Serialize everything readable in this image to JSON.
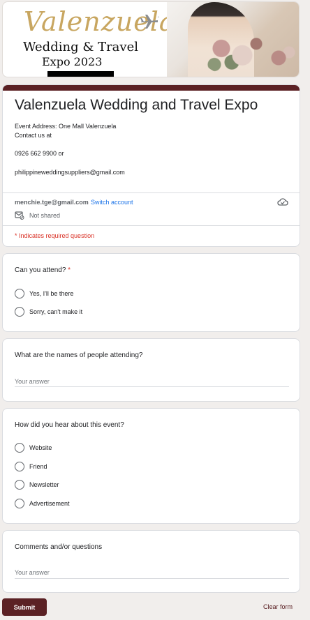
{
  "banner": {
    "title": "Valenzuela",
    "subtitle_line1": "Wedding & Travel",
    "subtitle_line2": "Expo 2023"
  },
  "header": {
    "form_title": "Valenzuela Wedding and Travel Expo",
    "description": {
      "address": "Event Address: One Mall Valenzuela",
      "contact": "Contact us at",
      "phone": "0926 662 9900  or",
      "email": "philippineweddingsuppliers@gmail.com"
    },
    "account": {
      "email": "menchie.tge@gmail.com",
      "switch_label": "Switch account",
      "not_shared": "Not shared"
    },
    "required_note": "* Indicates required question"
  },
  "questions": {
    "attend": {
      "title": "Can you attend?",
      "required_mark": "*",
      "options": [
        "Yes,  I'll be there",
        "Sorry, can't make it"
      ]
    },
    "names": {
      "title": "What are the names of people attending?",
      "placeholder": "Your answer"
    },
    "hear": {
      "title": "How did you hear about this event?",
      "options": [
        "Website",
        "Friend",
        "Newsletter",
        "Advertisement"
      ]
    },
    "comments": {
      "title": "Comments and/or questions",
      "placeholder": "Your answer"
    }
  },
  "footer": {
    "submit_label": "Submit",
    "clear_label": "Clear form"
  },
  "colors": {
    "accent": "#5b2124",
    "background": "#f1eeec",
    "link": "#1a73e8",
    "required": "#d93025"
  }
}
